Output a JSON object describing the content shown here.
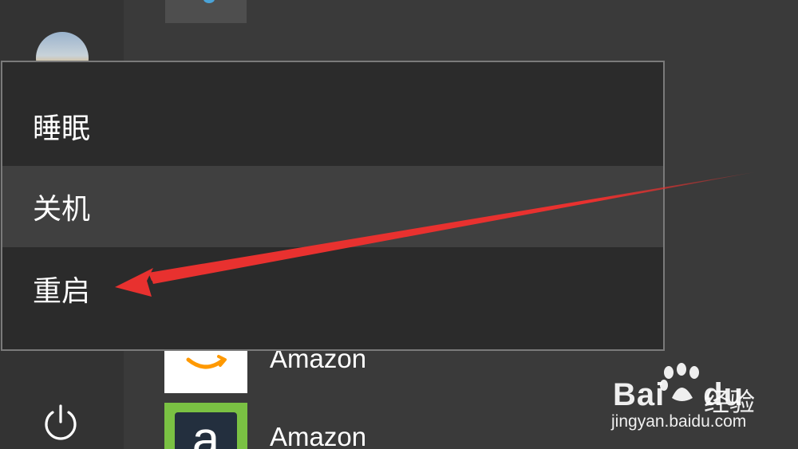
{
  "start_menu": {
    "apps": [
      {
        "name": "Amazon",
        "icon": "amazon-smile-icon"
      },
      {
        "name": "Amazon",
        "icon": "amazon-a-icon",
        "icon_color": "#7ac143"
      }
    ]
  },
  "power_menu": {
    "items": [
      {
        "label": "睡眠"
      },
      {
        "label": "关机",
        "highlighted": true
      },
      {
        "label": "重启",
        "annotated": true
      }
    ]
  },
  "annotation": {
    "arrow_color": "#e8312f",
    "points_to": "重启"
  },
  "watermark": {
    "brand": "Bai",
    "brand_suffix": "du",
    "chinese": "经验",
    "url": "jingyan.baidu.com"
  },
  "colors": {
    "menu_bg": "#2b2b2b",
    "menu_border": "#7a7a7a",
    "highlight_bg": "#404040",
    "background": "#3a3a3a"
  }
}
